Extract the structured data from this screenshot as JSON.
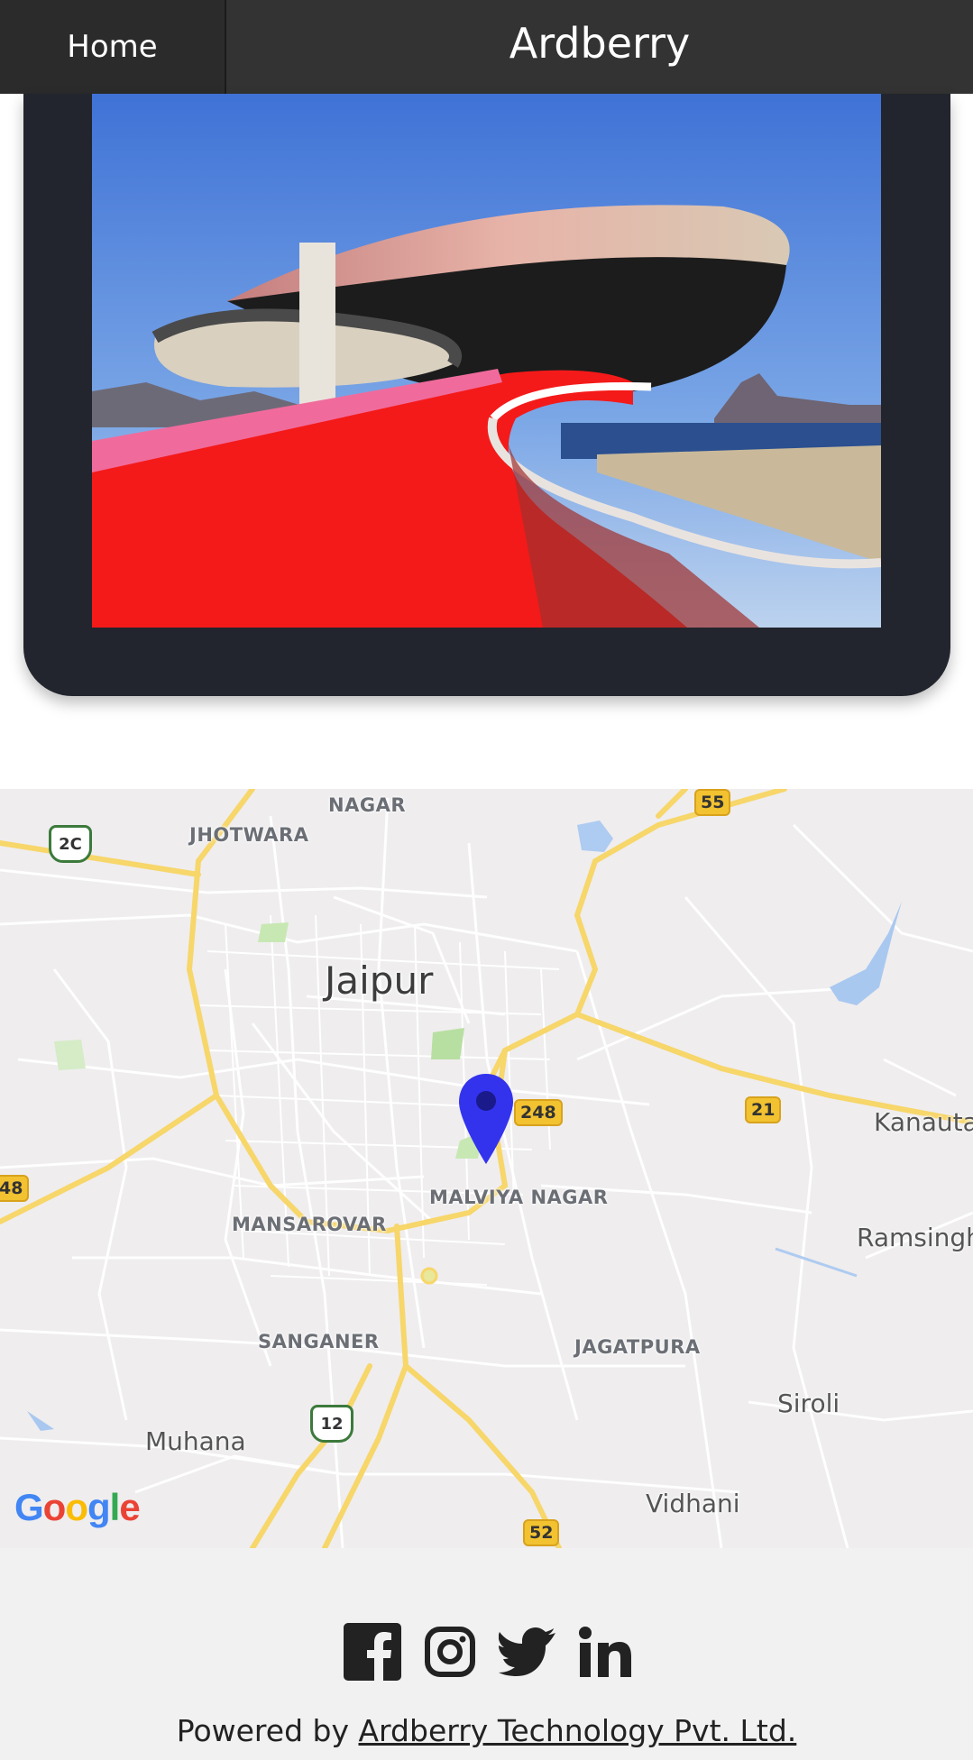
{
  "header": {
    "home_label": "Home",
    "title": "Ardberry"
  },
  "photo": {
    "description_icon": "building-photo"
  },
  "map": {
    "areas": {
      "nagar": "NAGAR",
      "jhotwara": "JHOTWARA",
      "malviya_nagar": "MALVIYA NAGAR",
      "mansarovar": "MANSAROVAR",
      "sanganer": "SANGANER",
      "jagatpura": "JAGATPURA"
    },
    "city": "Jaipur",
    "towns": {
      "kanauta": "Kanauta",
      "ramsingh": "Ramsingh",
      "siroli": "Siroli",
      "muhana": "Muhana",
      "vidhani": "Vidhani"
    },
    "shields": {
      "h55": "55",
      "h2c": "2C",
      "h248": "248",
      "h21": "21",
      "h48": "48",
      "h12": "12",
      "h52": "52"
    },
    "pin_color": "#3333ee",
    "google": {
      "G": "G",
      "o1": "o",
      "o2": "o",
      "g": "g",
      "l": "l",
      "e": "e"
    }
  },
  "footer": {
    "powered_prefix": "Powered by ",
    "company_link": "Ardberry Technology Pvt. Ltd.",
    "social": [
      "facebook-icon",
      "instagram-icon",
      "twitter-icon",
      "linkedin-icon"
    ]
  }
}
